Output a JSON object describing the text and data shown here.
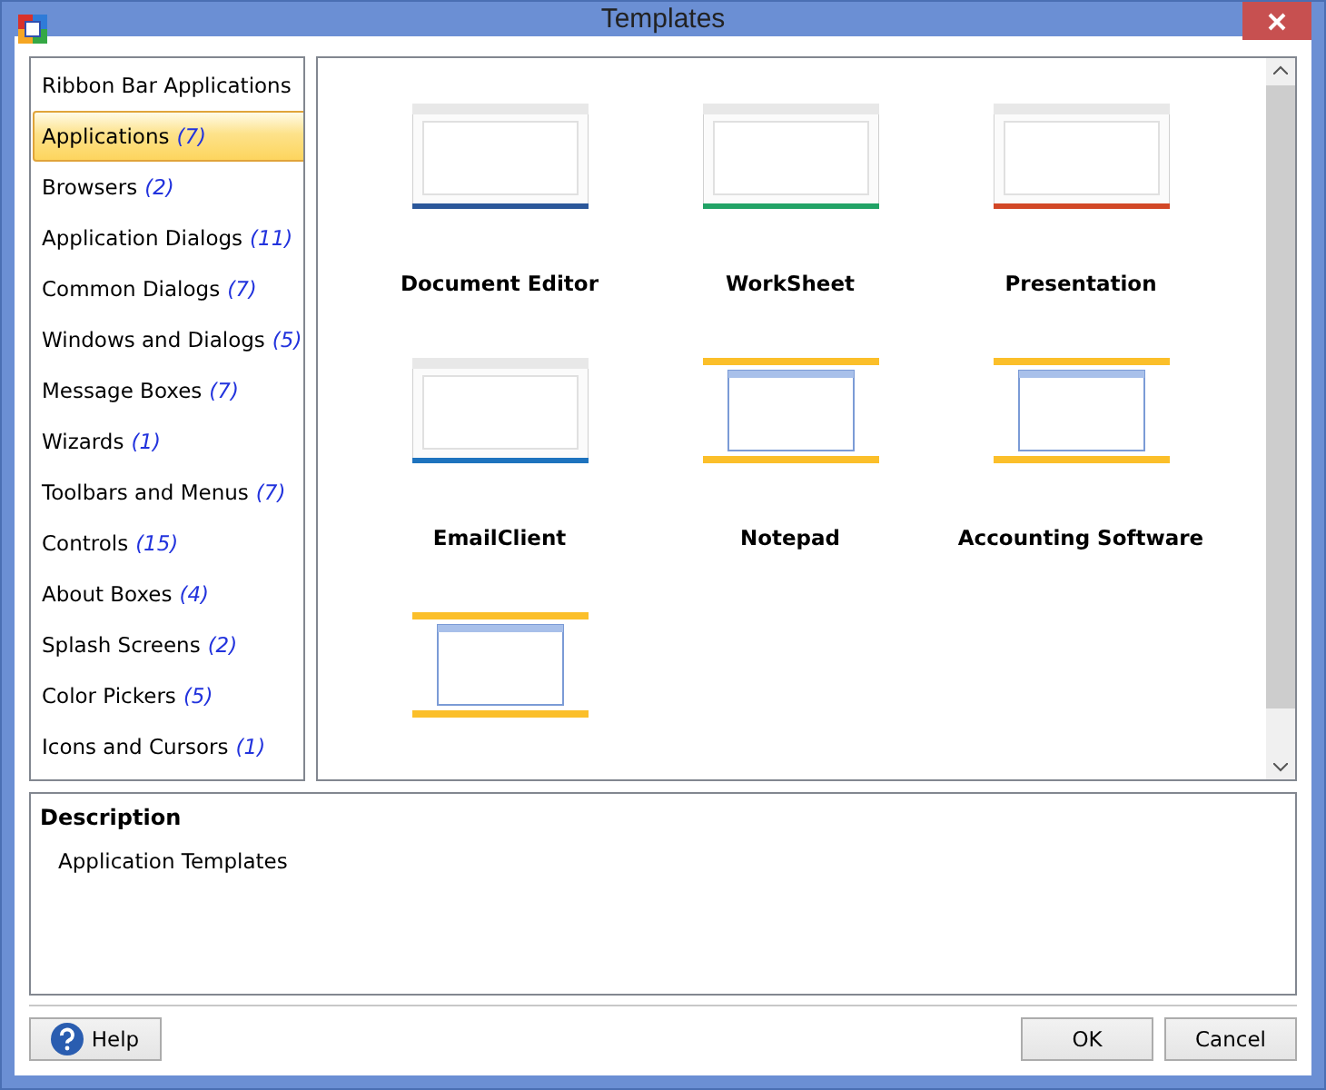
{
  "window": {
    "title": "Templates"
  },
  "categories": [
    {
      "label": "Ribbon Bar Applications",
      "selected": false
    },
    {
      "label": "Applications",
      "count": "(7)",
      "selected": true
    },
    {
      "label": "Browsers",
      "count": "(2)",
      "selected": false
    },
    {
      "label": "Application Dialogs",
      "count": "(11)",
      "selected": false
    },
    {
      "label": "Common Dialogs",
      "count": "(7)",
      "selected": false
    },
    {
      "label": "Windows and Dialogs",
      "count": "(5)",
      "selected": false
    },
    {
      "label": "Message Boxes",
      "count": "(7)",
      "selected": false
    },
    {
      "label": "Wizards",
      "count": "(1)",
      "selected": false
    },
    {
      "label": "Toolbars and Menus",
      "count": "(7)",
      "selected": false
    },
    {
      "label": "Controls",
      "count": "(15)",
      "selected": false
    },
    {
      "label": "About Boxes",
      "count": "(4)",
      "selected": false
    },
    {
      "label": "Splash Screens",
      "count": "(2)",
      "selected": false
    },
    {
      "label": "Color Pickers",
      "count": "(5)",
      "selected": false
    },
    {
      "label": "Icons and Cursors",
      "count": "(1)",
      "selected": false
    }
  ],
  "templates": [
    {
      "kind": "plain",
      "label": "Document Editor",
      "color": "#2b579a"
    },
    {
      "kind": "plain",
      "label": "WorkSheet",
      "color": "#21a366"
    },
    {
      "kind": "plain",
      "label": "Presentation",
      "color": "#d24726"
    },
    {
      "kind": "plain",
      "label": "EmailClient",
      "color": "#1e73be"
    },
    {
      "kind": "framed",
      "label": "Notepad",
      "color": "#fbbf2a"
    },
    {
      "kind": "framed",
      "label": "Accounting Software",
      "color": "#fbbf2a"
    },
    {
      "kind": "framed",
      "color": "#fbbf2a"
    }
  ],
  "description": {
    "heading": "Description",
    "text": "Application Templates"
  },
  "buttons": {
    "help": "Help",
    "ok": "OK",
    "cancel": "Cancel"
  }
}
